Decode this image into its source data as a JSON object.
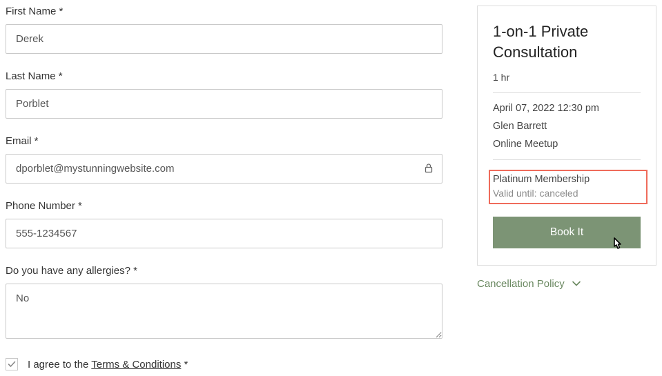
{
  "form": {
    "firstName": {
      "label": "First Name *",
      "value": "Derek"
    },
    "lastName": {
      "label": "Last Name *",
      "value": "Porblet"
    },
    "email": {
      "label": "Email *",
      "value": "dporblet@mystunningwebsite.com"
    },
    "phone": {
      "label": "Phone Number *",
      "value": "555-1234567"
    },
    "allergies": {
      "label": "Do you have any allergies? *",
      "value": "No"
    },
    "agree": {
      "prefix": "I agree to the ",
      "linkText": "Terms & Conditions",
      "suffix": " *",
      "checked": true
    }
  },
  "summary": {
    "title": "1-on-1 Private Consultation",
    "duration": "1 hr",
    "datetime": "April 07, 2022 12:30 pm",
    "staff": "Glen Barrett",
    "location": "Online Meetup",
    "membership": {
      "name": "Platinum Membership",
      "valid": "Valid until: canceled"
    },
    "bookButton": "Book It"
  },
  "cancellationPolicy": "Cancellation Policy"
}
